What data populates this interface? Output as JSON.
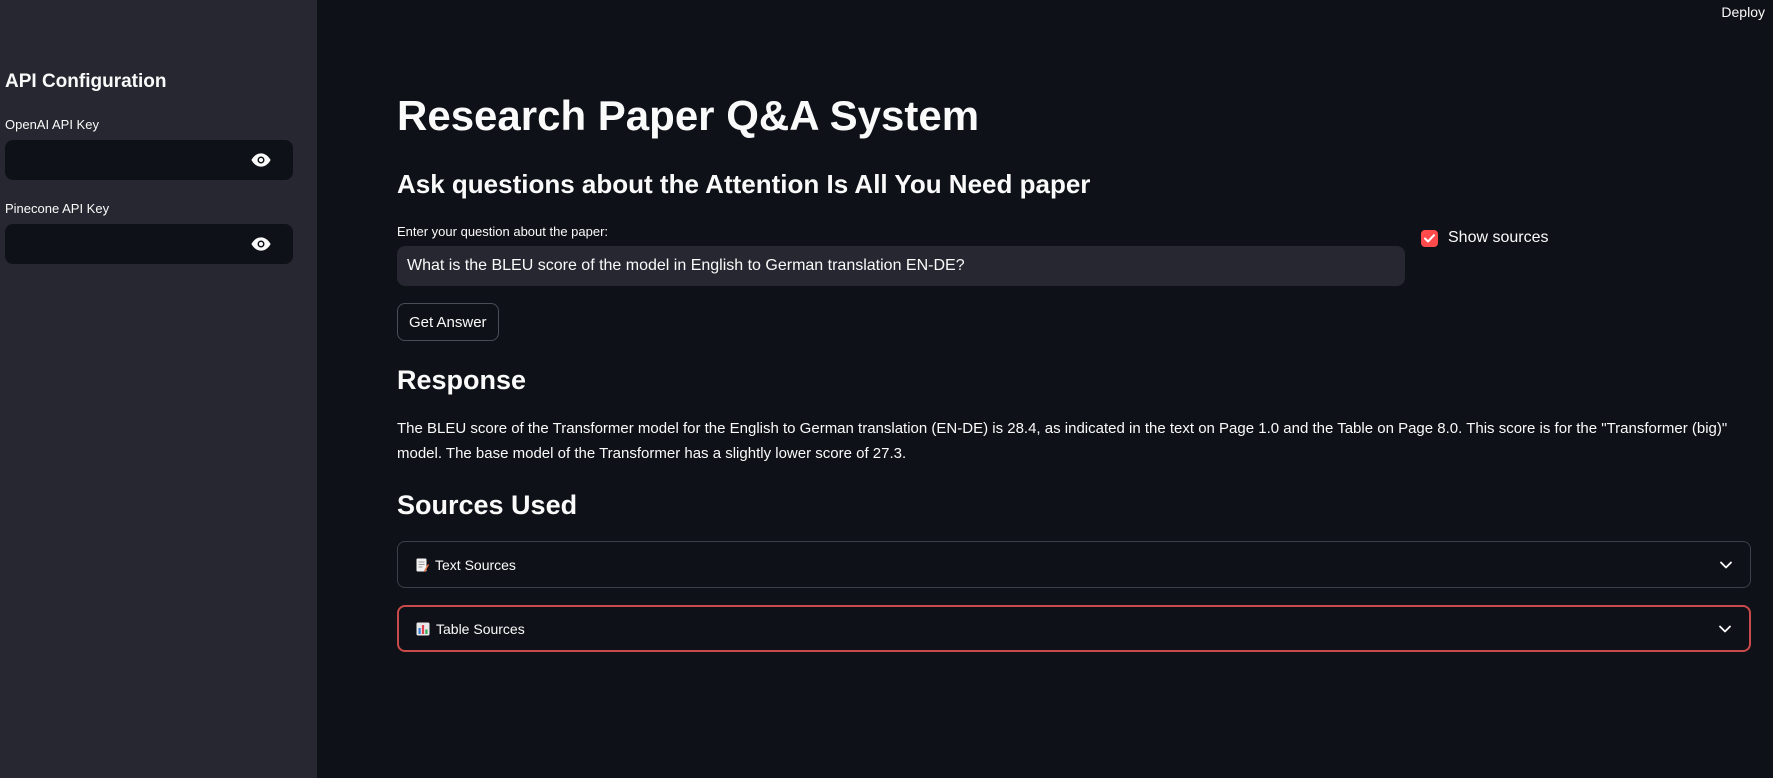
{
  "header": {
    "deploy_label": "Deploy"
  },
  "sidebar": {
    "title": "API Configuration",
    "openai": {
      "label": "OpenAI API Key",
      "value": "",
      "icon": "eye-icon"
    },
    "pinecone": {
      "label": "Pinecone API Key",
      "value": "",
      "icon": "eye-icon"
    }
  },
  "main": {
    "title": "Research Paper Q&A System",
    "subtitle": "Ask questions about the Attention Is All You Need paper",
    "question_label": "Enter your question about the paper:",
    "question_value": "What is the BLEU score of the model in English to German translation EN-DE?",
    "show_sources_label": "Show sources",
    "show_sources_checked": true,
    "get_answer_label": "Get Answer",
    "response_title": "Response",
    "response_text": "The BLEU score of the Transformer model for the English to German translation (EN-DE) is 28.4, as indicated in the text on Page 1.0 and the Table on Page 8.0. This score is for the \"Transformer (big)\" model. The base model of the Transformer has a slightly lower score of 27.3.",
    "sources_title": "Sources Used",
    "expanders": [
      {
        "label": "Text Sources",
        "icon": "memo-icon"
      },
      {
        "label": "Table Sources",
        "icon": "bar-chart-icon"
      }
    ]
  },
  "colors": {
    "background": "#0e1117",
    "sidebar": "#262730",
    "accent": "#ff4b4b",
    "input_background": "#262730",
    "focus_border": "#c94a4a"
  }
}
